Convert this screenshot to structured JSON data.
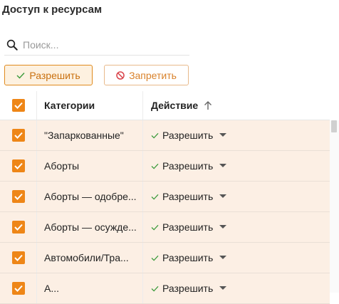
{
  "page": {
    "title": "Доступ к ресурсам"
  },
  "search": {
    "placeholder": "Поиск..."
  },
  "buttons": {
    "allow": "Разрешить",
    "deny": "Запретить"
  },
  "table": {
    "headers": {
      "category": "Категории",
      "action": "Действие"
    },
    "rows": [
      {
        "category": "\"Запаркованные\"",
        "action": "Разрешить",
        "checked": true
      },
      {
        "category": "Аборты",
        "action": "Разрешить",
        "checked": true
      },
      {
        "category": "Аборты — одобре...",
        "action": "Разрешить",
        "checked": true
      },
      {
        "category": "Аборты — осужде...",
        "action": "Разрешить",
        "checked": true
      },
      {
        "category": "Автомобили/Тра...",
        "action": "Разрешить",
        "checked": true
      },
      {
        "category": "А...",
        "action": "Разрешить",
        "checked": true
      }
    ]
  },
  "colors": {
    "accent": "#ee8617",
    "row_selected_bg": "#fcefe4",
    "allow_check": "#3a9a3a"
  }
}
